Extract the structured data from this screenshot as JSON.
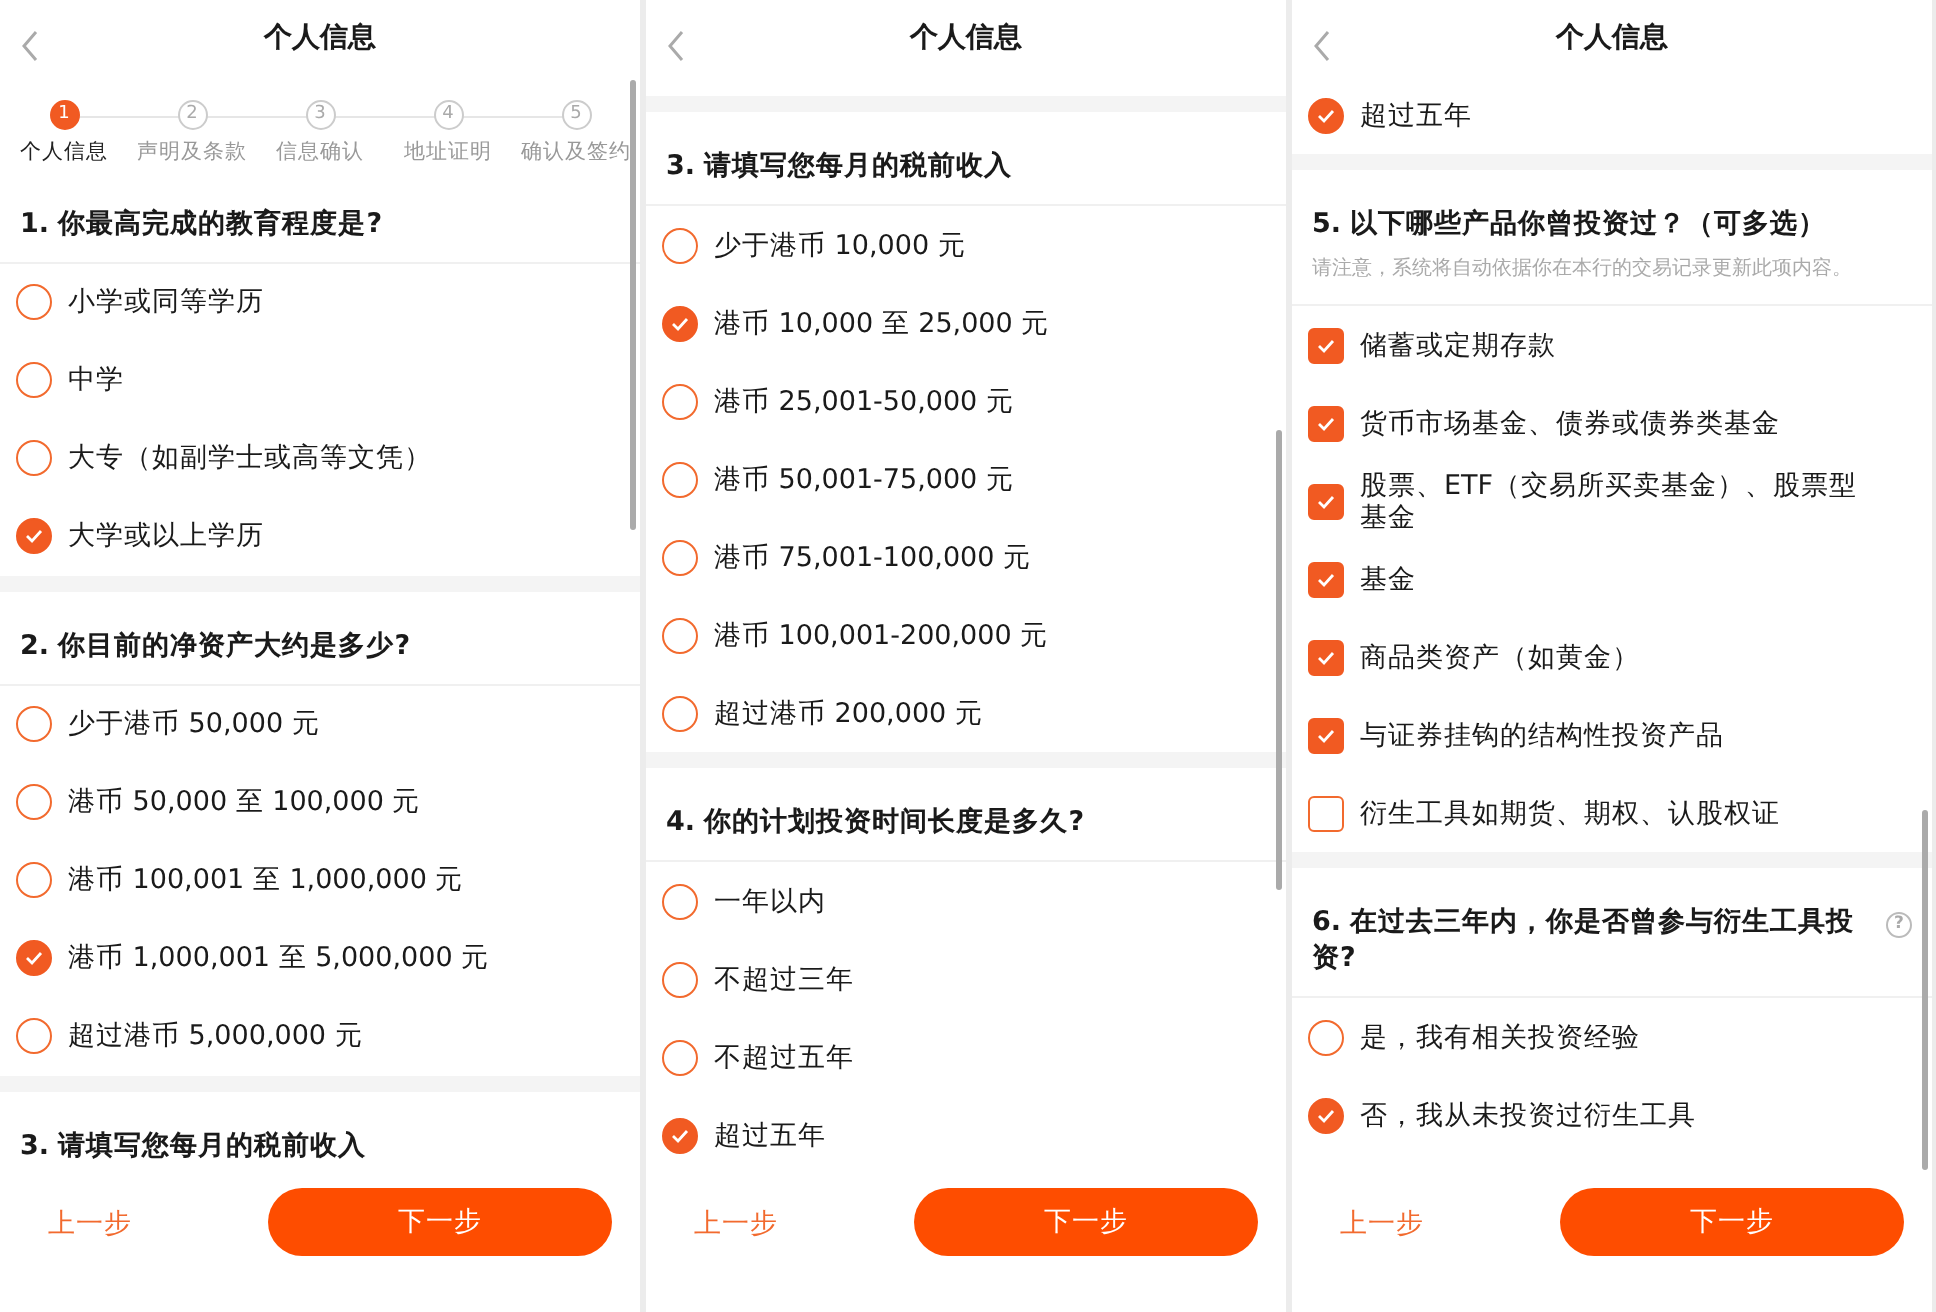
{
  "panels": [
    {
      "title": "个人信息",
      "steps": [
        {
          "number": "1",
          "label": "个人信息",
          "selected": true
        },
        {
          "number": "2",
          "label": "声明及条款",
          "selected": false
        },
        {
          "number": "3",
          "label": "信息确认",
          "selected": false
        },
        {
          "number": "4",
          "label": "地址证明",
          "selected": false
        },
        {
          "number": "5",
          "label": "确认及签约",
          "selected": false
        }
      ],
      "sections": [
        {
          "title": "1. 你最高完成的教育程度是?",
          "kind": "radio",
          "options": [
            {
              "label": "小学或同等学历",
              "selected": false
            },
            {
              "label": "中学",
              "selected": false
            },
            {
              "label": "大专（如副学士或高等文凭）",
              "selected": false
            },
            {
              "label": "大学或以上学历",
              "selected": true
            }
          ]
        },
        {
          "title": "2. 你目前的净资产大约是多少?",
          "kind": "radio",
          "options": [
            {
              "label": "少于港币 50,000 元",
              "selected": false
            },
            {
              "label": "港币 50,000 至 100,000 元",
              "selected": false
            },
            {
              "label": "港币 100,001 至 1,000,000 元",
              "selected": false
            },
            {
              "label": "港币 1,000,001 至 5,000,000 元",
              "selected": true
            },
            {
              "label": "超过港币 5,000,000 元",
              "selected": false
            }
          ]
        },
        {
          "title": "3. 请填写您每月的税前收入"
        }
      ],
      "prev": "上一步",
      "next": "下一步"
    },
    {
      "title": "个人信息",
      "sections": [
        {
          "title": "3. 请填写您每月的税前收入",
          "kind": "radio",
          "options": [
            {
              "label": "少于港币 10,000 元",
              "selected": false
            },
            {
              "label": "港币 10,000 至 25,000 元",
              "selected": true
            },
            {
              "label": "港币 25,001-50,000 元",
              "selected": false
            },
            {
              "label": "港币 50,001-75,000 元",
              "selected": false
            },
            {
              "label": "港币 75,001-100,000 元",
              "selected": false
            },
            {
              "label": "港币 100,001-200,000 元",
              "selected": false
            },
            {
              "label": "超过港币 200,000 元",
              "selected": false
            }
          ]
        },
        {
          "title": "4. 你的计划投资时间长度是多久?",
          "kind": "radio",
          "options": [
            {
              "label": "一年以内",
              "selected": false
            },
            {
              "label": "不超过三年",
              "selected": false
            },
            {
              "label": "不超过五年",
              "selected": false
            },
            {
              "label": "超过五年",
              "selected": true
            }
          ]
        }
      ],
      "prev": "上一步",
      "next": "下一步"
    },
    {
      "title": "个人信息",
      "sections": [
        {
          "kind": "radio",
          "options": [
            {
              "label": "超过五年",
              "selected": true
            }
          ]
        },
        {
          "title": "5. 以下哪些产品你曾投资过？（可多选）",
          "note": "请注意，系统将自动依据你在本行的交易记录更新此项内容。",
          "kind": "checkbox",
          "options": [
            {
              "label": "储蓄或定期存款",
              "checked": true
            },
            {
              "label": "货币市场基金、债券或债券类基金",
              "checked": true
            },
            {
              "label": "股票、ETF（交易所买卖基金）、股票型基金",
              "checked": true
            },
            {
              "label": "基金",
              "checked": true
            },
            {
              "label": "商品类资产（如黄金）",
              "checked": true
            },
            {
              "label": "与证券挂钩的结构性投资产品",
              "checked": true
            },
            {
              "label": "衍生工具如期货、期权、认股权证",
              "checked": false
            }
          ]
        },
        {
          "title": "6. 在过去三年内，你是否曾参与衍生工具投资?",
          "help": "?",
          "kind": "radio",
          "options": [
            {
              "label": "是，我有相关投资经验",
              "selected": false
            },
            {
              "label": "否，我从未投资过衍生工具",
              "selected": true
            }
          ]
        }
      ],
      "prev": "上一步",
      "next": "下一步"
    }
  ]
}
